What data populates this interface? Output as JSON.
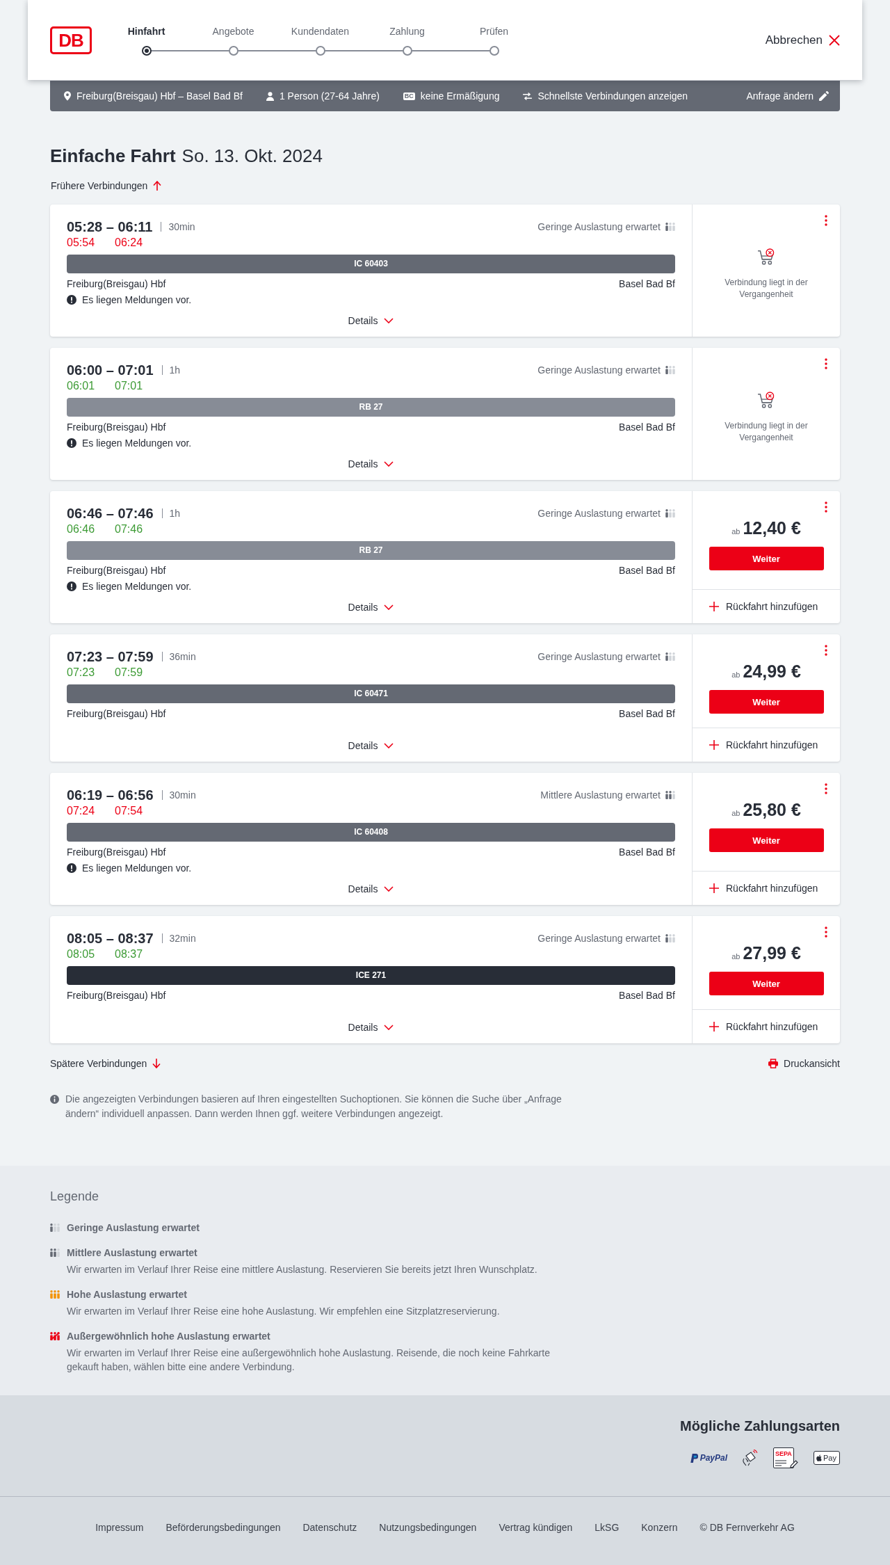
{
  "header": {
    "logo": "DB",
    "steps": [
      {
        "label": "Hinfahrt",
        "selected": true
      },
      {
        "label": "Angebote",
        "selected": false
      },
      {
        "label": "Kundendaten",
        "selected": false
      },
      {
        "label": "Zahlung",
        "selected": false
      },
      {
        "label": "Prüfen",
        "selected": false
      }
    ],
    "cancel": "Abbrechen"
  },
  "query_bar": {
    "items": [
      {
        "kind": "route",
        "label": "Freiburg(Breisgau) Hbf – Basel Bad Bf"
      },
      {
        "kind": "travellers",
        "label": "1 Person (27-64 Jahre)"
      },
      {
        "kind": "discount",
        "badge": "BC",
        "label": "keine Ermäßigung"
      },
      {
        "kind": "sort",
        "label": "Schnellste Verbindungen anzeigen"
      }
    ],
    "edit": "Anfrage ändern"
  },
  "heading": {
    "title": "Einfache Fahrt",
    "date": "So. 13. Okt. 2024"
  },
  "earlier_link": "Frühere Verbindungen",
  "connections": [
    {
      "time": "05:28 – 06:11",
      "duration": "30min",
      "occupancy": {
        "label": "Geringe Auslastung erwartet",
        "kind": "low"
      },
      "realtime": {
        "departure": "05:54",
        "arrival": "06:24",
        "delayed": true
      },
      "train": {
        "label": "IC 60403",
        "color": "#646973"
      },
      "from": "Freiburg(Breisgau) Hbf",
      "to": "Basel Bad Bf",
      "notice": "Es liegen Meldungen vor.",
      "details": "Details",
      "offer": {
        "kind": "past",
        "message": "Verbindung liegt in der Vergangenheit"
      }
    },
    {
      "time": "06:00 – 07:01",
      "duration": "1h",
      "occupancy": {
        "label": "Geringe Auslastung erwartet",
        "kind": "low"
      },
      "realtime": {
        "departure": "06:01",
        "arrival": "07:01",
        "delayed": false
      },
      "train": {
        "label": "RB 27",
        "color": "#878c96"
      },
      "from": "Freiburg(Breisgau) Hbf",
      "to": "Basel Bad Bf",
      "notice": "Es liegen Meldungen vor.",
      "details": "Details",
      "offer": {
        "kind": "past",
        "message": "Verbindung liegt in der Vergangenheit"
      }
    },
    {
      "time": "06:46 – 07:46",
      "duration": "1h",
      "occupancy": {
        "label": "Geringe Auslastung erwartet",
        "kind": "low"
      },
      "realtime": {
        "departure": "06:46",
        "arrival": "07:46",
        "delayed": false
      },
      "train": {
        "label": "RB 27",
        "color": "#878c96"
      },
      "from": "Freiburg(Breisgau) Hbf",
      "to": "Basel Bad Bf",
      "notice": "Es liegen Meldungen vor.",
      "details": "Details",
      "offer": {
        "kind": "fare",
        "prefix": "ab",
        "price": "12,40 €",
        "button": "Weiter",
        "return_trip": "Rückfahrt hinzufügen"
      }
    },
    {
      "time": "07:23 – 07:59",
      "duration": "36min",
      "occupancy": {
        "label": "Geringe Auslastung erwartet",
        "kind": "low"
      },
      "realtime": {
        "departure": "07:23",
        "arrival": "07:59",
        "delayed": false
      },
      "train": {
        "label": "IC 60471",
        "color": "#646973"
      },
      "from": "Freiburg(Breisgau) Hbf",
      "to": "Basel Bad Bf",
      "details": "Details",
      "offer": {
        "kind": "fare",
        "prefix": "ab",
        "price": "24,99 €",
        "button": "Weiter",
        "return_trip": "Rückfahrt hinzufügen"
      }
    },
    {
      "time": "06:19 – 06:56",
      "duration": "30min",
      "occupancy": {
        "label": "Mittlere Auslastung erwartet",
        "kind": "medium"
      },
      "realtime": {
        "departure": "07:24",
        "arrival": "07:54",
        "delayed": true
      },
      "train": {
        "label": "IC 60408",
        "color": "#646973"
      },
      "from": "Freiburg(Breisgau) Hbf",
      "to": "Basel Bad Bf",
      "notice": "Es liegen Meldungen vor.",
      "details": "Details",
      "offer": {
        "kind": "fare",
        "prefix": "ab",
        "price": "25,80 €",
        "button": "Weiter",
        "return_trip": "Rückfahrt hinzufügen"
      }
    },
    {
      "time": "08:05 – 08:37",
      "duration": "32min",
      "occupancy": {
        "label": "Geringe Auslastung erwartet",
        "kind": "low"
      },
      "realtime": {
        "departure": "08:05",
        "arrival": "08:37",
        "delayed": false
      },
      "train": {
        "label": "ICE 271",
        "color": "#282d37"
      },
      "from": "Freiburg(Breisgau) Hbf",
      "to": "Basel Bad Bf",
      "details": "Details",
      "offer": {
        "kind": "fare",
        "prefix": "ab",
        "price": "27,99 €",
        "button": "Weiter",
        "return_trip": "Rückfahrt hinzufügen"
      }
    }
  ],
  "later_link": "Spätere Verbindungen",
  "print_link": "Druckansicht",
  "info_note": "Die angezeigten Verbindungen basieren auf Ihren eingestellten Suchoptionen. Sie können die Suche über „Anfrage ändern“ individuell anpassen. Dann werden Ihnen ggf. weitere Verbindungen angezeigt.",
  "legend": {
    "title": "Legende",
    "items": [
      {
        "kind": "low",
        "title": "Geringe Auslastung erwartet"
      },
      {
        "kind": "medium",
        "title": "Mittlere Auslastung erwartet",
        "description": "Wir erwarten im Verlauf Ihrer Reise eine mittlere Auslastung. Reservieren Sie bereits jetzt Ihren Wunschplatz."
      },
      {
        "kind": "high",
        "title": "Hohe Auslastung erwartet",
        "description": "Wir erwarten im Verlauf Ihrer Reise eine hohe Auslastung. Wir empfehlen eine Sitzplatzreservierung."
      },
      {
        "kind": "exceptional",
        "title": "Außergewöhnlich hohe Auslastung erwartet",
        "description": "Wir erwarten im Verlauf Ihrer Reise eine außergewöhnlich hohe Auslastung. Reisende, die noch keine Fahrkarte gekauft haben, wählen bitte eine andere Verbindung."
      }
    ]
  },
  "payment": {
    "title": "Mögliche Zahlungsarten",
    "methods": [
      {
        "kind": "paypal",
        "label": "PayPal"
      },
      {
        "kind": "contactless"
      },
      {
        "kind": "direct-debit",
        "label": "SEPA"
      },
      {
        "kind": "wallet",
        "label": "Pay"
      }
    ]
  },
  "footer": {
    "links": [
      "Impressum",
      "Beförderungsbedingungen",
      "Datenschutz",
      "Nutzungsbedingungen",
      "Vertrag kündigen",
      "LkSG",
      "Konzern"
    ],
    "copyright": "© DB Fernverkehr AG"
  }
}
